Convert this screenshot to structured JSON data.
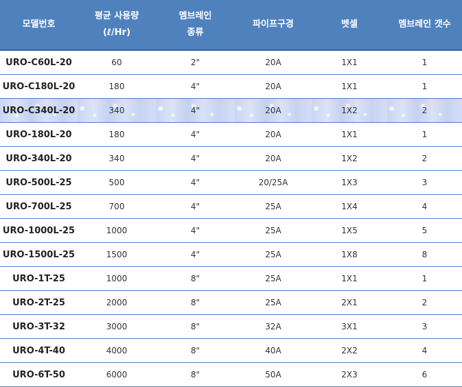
{
  "headers": {
    "model": "모델번호",
    "usage_line1": "평균 사용량",
    "usage_line2": "(ℓ/Hr)",
    "membrane_line1": "멤브레인",
    "membrane_line2": "종류",
    "pipe": "파이프구경",
    "vessel": "벳셀",
    "count": "멤브레인 갯수"
  },
  "highlight_row_index": 2,
  "rows": [
    {
      "model": "URO-C60L-20",
      "usage": "60",
      "membrane": "2\"",
      "pipe": "20A",
      "vessel": "1X1",
      "count": "1"
    },
    {
      "model": "URO-C180L-20",
      "usage": "180",
      "membrane": "4\"",
      "pipe": "20A",
      "vessel": "1X1",
      "count": "1"
    },
    {
      "model": "URO-C340L-20",
      "usage": "340",
      "membrane": "4\"",
      "pipe": "20A",
      "vessel": "1X2",
      "count": "2"
    },
    {
      "model": "URO-180L-20",
      "usage": "180",
      "membrane": "4\"",
      "pipe": "20A",
      "vessel": "1X1",
      "count": "1"
    },
    {
      "model": "URO-340L-20",
      "usage": "340",
      "membrane": "4\"",
      "pipe": "20A",
      "vessel": "1X2",
      "count": "2"
    },
    {
      "model": "URO-500L-25",
      "usage": "500",
      "membrane": "4\"",
      "pipe": "20/25A",
      "vessel": "1X3",
      "count": "3"
    },
    {
      "model": "URO-700L-25",
      "usage": "700",
      "membrane": "4\"",
      "pipe": "25A",
      "vessel": "1X4",
      "count": "4"
    },
    {
      "model": "URO-1000L-25",
      "usage": "1000",
      "membrane": "4\"",
      "pipe": "25A",
      "vessel": "1X5",
      "count": "5"
    },
    {
      "model": "URO-1500L-25",
      "usage": "1500",
      "membrane": "4\"",
      "pipe": "25A",
      "vessel": "1X8",
      "count": "8"
    },
    {
      "model": "URO-1T-25",
      "usage": "1000",
      "membrane": "8\"",
      "pipe": "25A",
      "vessel": "1X1",
      "count": "1"
    },
    {
      "model": "URO-2T-25",
      "usage": "2000",
      "membrane": "8\"",
      "pipe": "25A",
      "vessel": "2X1",
      "count": "2"
    },
    {
      "model": "URO-3T-32",
      "usage": "3000",
      "membrane": "8\"",
      "pipe": "32A",
      "vessel": "3X1",
      "count": "3"
    },
    {
      "model": "URO-4T-40",
      "usage": "4000",
      "membrane": "8\"",
      "pipe": "40A",
      "vessel": "2X2",
      "count": "4"
    },
    {
      "model": "URO-6T-50",
      "usage": "6000",
      "membrane": "8\"",
      "pipe": "50A",
      "vessel": "2X3",
      "count": "6"
    }
  ]
}
